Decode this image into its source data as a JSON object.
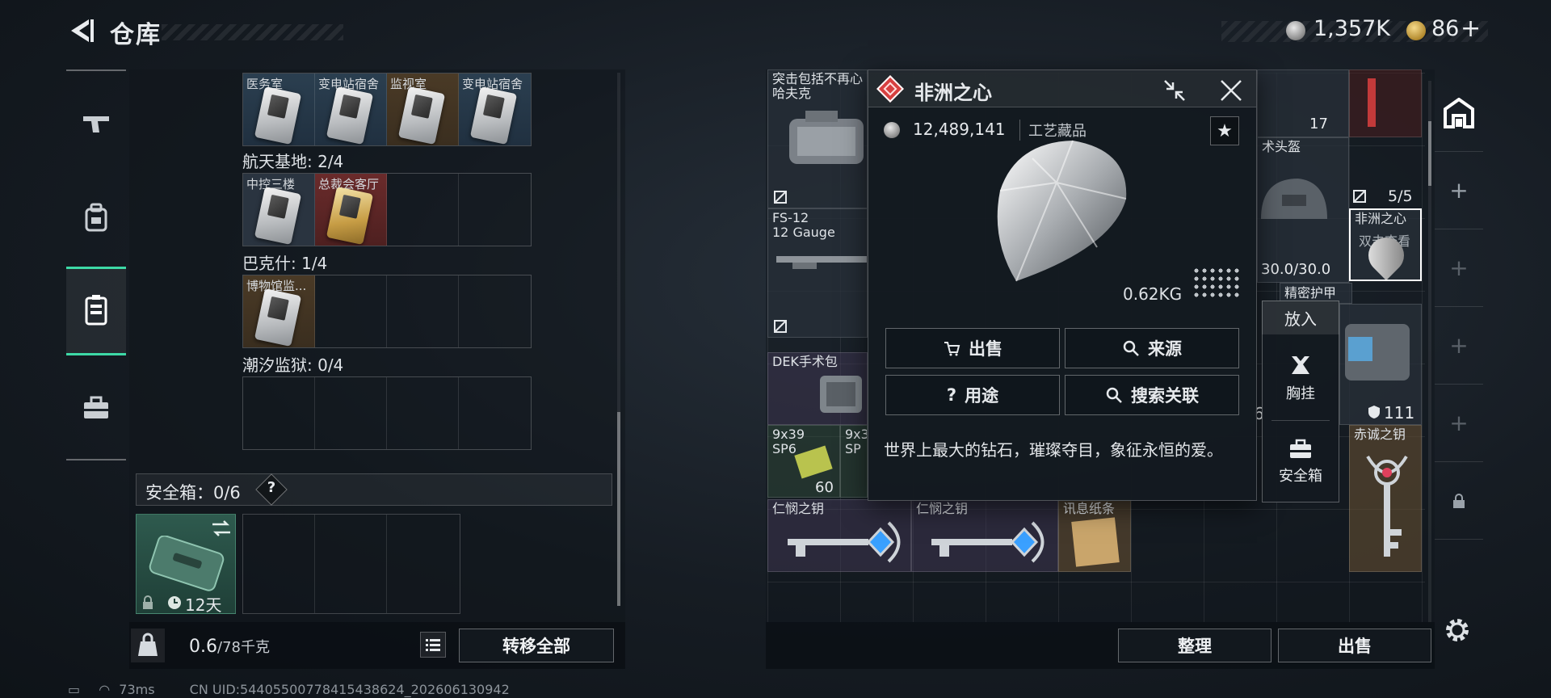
{
  "header": {
    "title": "仓库",
    "currency_silver": "1,357K",
    "currency_gold": "86",
    "currency_gold_plus": "+"
  },
  "left": {
    "row1_labels": [
      "医务室",
      "变电站宿舍",
      "监视室",
      "变电站宿舍"
    ],
    "section_space": "航天基地: 2/4",
    "row2_labels": [
      "中控三楼",
      "总裁会客厅"
    ],
    "section_baku": "巴克什: 1/4",
    "row3_labels": [
      "博物馆监..."
    ],
    "section_tide": "潮汐监狱: 0/4",
    "safe_title": "安全箱：0/6",
    "safe_help": "?",
    "safe_days": "12天",
    "weight_current": "0.6",
    "weight_max": "/78千克",
    "transfer_all": "转移全部"
  },
  "status": {
    "ping": "73ms",
    "uid": "CN UID:544055007784154386​24_202606130942"
  },
  "right": {
    "items": {
      "top_left_line1": "突击包括不再心",
      "top_left_line2": "哈夫克",
      "fs12_line1": "FS-12",
      "fs12_line2": "12 Gauge",
      "dek": "DEK手术包",
      "ammo1_line1": "9x39",
      "ammo1_line2": "SP6",
      "ammo1_count": "60",
      "ammo2_line1": "9x3",
      "ammo2_line2": "SP",
      "key1": "仁悯之钥",
      "key2": "仁悯之钥",
      "paper": "讯息纸条",
      "helmet": "术头盔",
      "helmet_durability": "30.0/30.0",
      "count_17": "17",
      "stack_55": "5/5",
      "heart_line1": "非洲之心",
      "heart_line2": "双击查看",
      "armor": "精密护甲",
      "armor_value": "111",
      "partial_digit": "6",
      "key3": "赤诚之钥"
    },
    "sort": "整理",
    "sell": "出售"
  },
  "popup": {
    "title": "非洲之心",
    "price": "12,489,141",
    "category": "工艺藏品",
    "favorite_icon": "★",
    "weight": "0.62KG",
    "btn_sell": "出售",
    "btn_source": "来源",
    "btn_use_mark": "?",
    "btn_use": "用途",
    "btn_search": "搜索关联",
    "description": "世界上最大的钻石，璀璨夺目，象征永恒的爱。"
  },
  "context_menu": {
    "title": "放入",
    "item1": "胸挂",
    "item2": "安全箱"
  },
  "colors": {
    "accent_green": "#3dd9a6",
    "popup_red": "#d74040",
    "rare_brown": "#4a3a26",
    "rare_red": "#6a2b2b"
  },
  "icons": [
    "back-icon",
    "pistol-icon",
    "backpack-icon",
    "vest-icon",
    "briefcase-icon",
    "search-icon",
    "collapse-icon",
    "close-icon",
    "star-icon",
    "gear-icon",
    "lock-icon",
    "list-icon"
  ]
}
